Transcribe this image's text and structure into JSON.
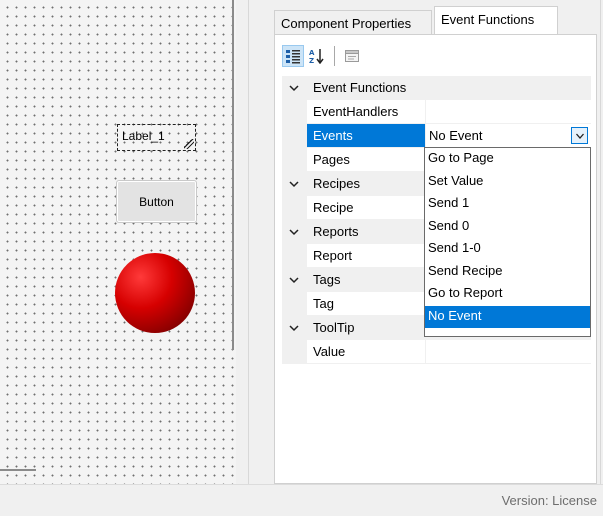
{
  "canvas": {
    "label_text": "Label_1",
    "button_text": "Button"
  },
  "tabs": [
    {
      "label": "Component Properties",
      "active": false
    },
    {
      "label": "Event Functions",
      "active": true
    }
  ],
  "toolbar": {
    "icons": [
      "categorized-icon",
      "alphabetical-sort-icon",
      "property-pages-icon"
    ]
  },
  "grid": {
    "rows": [
      {
        "kind": "category",
        "name": "Event Functions"
      },
      {
        "kind": "property",
        "name": "EventHandlers",
        "value": ""
      },
      {
        "kind": "property",
        "name": "Events",
        "value": "No Event",
        "selected": true
      },
      {
        "kind": "property",
        "name": "Pages",
        "value": ""
      },
      {
        "kind": "category",
        "name": "Recipes"
      },
      {
        "kind": "property",
        "name": "Recipe",
        "value": ""
      },
      {
        "kind": "category",
        "name": "Reports"
      },
      {
        "kind": "property",
        "name": "Report",
        "value": ""
      },
      {
        "kind": "category",
        "name": "Tags"
      },
      {
        "kind": "property",
        "name": "Tag",
        "value": ""
      },
      {
        "kind": "category",
        "name": "ToolTip"
      },
      {
        "kind": "property",
        "name": "Value",
        "value": ""
      }
    ]
  },
  "dropdown": {
    "options": [
      "Go to Page",
      "Set Value",
      "Send 1",
      "Send 0",
      "Send 1-0",
      "Send Recipe",
      "Go to Report",
      "No Event"
    ],
    "selected": "No Event"
  },
  "status": {
    "text": "Version: License"
  },
  "colors": {
    "selection": "#0078d7",
    "lamp": "#d60000"
  }
}
